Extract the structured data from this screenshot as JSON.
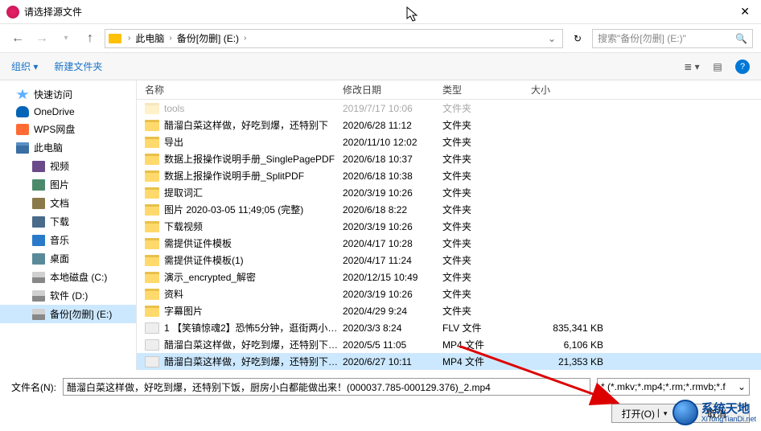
{
  "title": "请选择源文件",
  "breadcrumb": {
    "seg1": "此电脑",
    "seg2": "备份[勿删] (E:)"
  },
  "search_placeholder": "搜索\"备份[勿删] (E:)\"",
  "toolbar": {
    "organize": "组织",
    "newfolder": "新建文件夹"
  },
  "sidebar": [
    {
      "label": "快速访问",
      "icon": "i-star",
      "indent": false
    },
    {
      "label": "OneDrive",
      "icon": "i-cloud",
      "indent": false
    },
    {
      "label": "WPS网盘",
      "icon": "i-wps",
      "indent": false
    },
    {
      "label": "此电脑",
      "icon": "i-pc",
      "indent": false
    },
    {
      "label": "视频",
      "icon": "i-video",
      "indent": true
    },
    {
      "label": "图片",
      "icon": "i-image",
      "indent": true
    },
    {
      "label": "文档",
      "icon": "i-doc",
      "indent": true
    },
    {
      "label": "下载",
      "icon": "i-download",
      "indent": true
    },
    {
      "label": "音乐",
      "icon": "i-music",
      "indent": true
    },
    {
      "label": "桌面",
      "icon": "i-desktop",
      "indent": true
    },
    {
      "label": "本地磁盘 (C:)",
      "icon": "i-drive",
      "indent": true
    },
    {
      "label": "软件 (D:)",
      "icon": "i-drive",
      "indent": true
    },
    {
      "label": "备份[勿删] (E:)",
      "icon": "i-drive",
      "indent": true,
      "selected": true
    }
  ],
  "columns": {
    "name": "名称",
    "date": "修改日期",
    "type": "类型",
    "size": "大小"
  },
  "files": [
    {
      "name": "tools",
      "date": "2019/7/17 10:06",
      "type": "文件夹",
      "size": "",
      "icon": "i-folder",
      "cut": true
    },
    {
      "name": "醋溜白菜这样做，好吃到爆，还特别下",
      "date": "2020/6/28 11:12",
      "type": "文件夹",
      "size": "",
      "icon": "i-folder"
    },
    {
      "name": "导出",
      "date": "2020/11/10 12:02",
      "type": "文件夹",
      "size": "",
      "icon": "i-folder"
    },
    {
      "name": "数据上报操作说明手册_SinglePagePDF",
      "date": "2020/6/18 10:37",
      "type": "文件夹",
      "size": "",
      "icon": "i-folder"
    },
    {
      "name": "数据上报操作说明手册_SplitPDF",
      "date": "2020/6/18 10:38",
      "type": "文件夹",
      "size": "",
      "icon": "i-folder"
    },
    {
      "name": "提取词汇",
      "date": "2020/3/19 10:26",
      "type": "文件夹",
      "size": "",
      "icon": "i-folder"
    },
    {
      "name": "图片 2020-03-05 11;49;05 (完整)",
      "date": "2020/6/18 8:22",
      "type": "文件夹",
      "size": "",
      "icon": "i-folder"
    },
    {
      "name": "下载视频",
      "date": "2020/3/19 10:26",
      "type": "文件夹",
      "size": "",
      "icon": "i-folder"
    },
    {
      "name": "需提供证件模板",
      "date": "2020/4/17 10:28",
      "type": "文件夹",
      "size": "",
      "icon": "i-folder"
    },
    {
      "name": "需提供证件模板(1)",
      "date": "2020/4/17 11:24",
      "type": "文件夹",
      "size": "",
      "icon": "i-folder"
    },
    {
      "name": "演示_encrypted_解密",
      "date": "2020/12/15 10:49",
      "type": "文件夹",
      "size": "",
      "icon": "i-folder"
    },
    {
      "name": "资料",
      "date": "2020/3/19 10:26",
      "type": "文件夹",
      "size": "",
      "icon": "i-folder"
    },
    {
      "name": "字幕图片",
      "date": "2020/4/29 9:24",
      "type": "文件夹",
      "size": "",
      "icon": "i-folder"
    },
    {
      "name": "1 【笑镇惊魂2】恐怖5分钟，逛街两小时...",
      "date": "2020/3/3 8:24",
      "type": "FLV 文件",
      "size": "835,341 KB",
      "icon": "i-file"
    },
    {
      "name": "醋溜白菜这样做，好吃到爆，还特别下饭...",
      "date": "2020/5/5 11:05",
      "type": "MP4 文件",
      "size": "6,106 KB",
      "icon": "i-file"
    },
    {
      "name": "醋溜白菜这样做，好吃到爆，还特别下饭...",
      "date": "2020/6/27 10:11",
      "type": "MP4 文件",
      "size": "21,353 KB",
      "icon": "i-file",
      "selected": true
    }
  ],
  "filename_label": "文件名(N):",
  "filename_value": "醋溜白菜这样做，好吃到爆，还特别下饭，厨房小白都能做出来！(000037.785-000129.376)_2.mp4",
  "filter": "* (*.mkv;*.mp4;*.rm;*.rmvb;*.f",
  "open_btn": "打开(O)",
  "cancel_btn": "取消",
  "watermark": {
    "main": "系统天地",
    "sub": "XiTongTianDi.net"
  }
}
